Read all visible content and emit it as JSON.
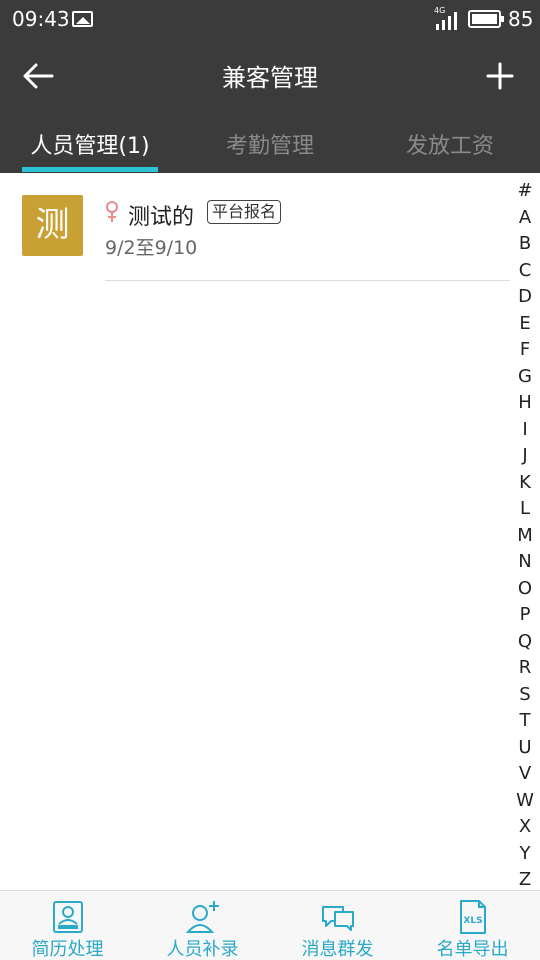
{
  "status_bar": {
    "time": "09:43",
    "network": "4G",
    "battery_level": "85"
  },
  "header": {
    "title": "兼客管理",
    "back_icon": "arrow-left-icon",
    "add_icon": "plus-icon"
  },
  "tabs": [
    {
      "label": "人员管理(1)",
      "active": true
    },
    {
      "label": "考勤管理",
      "active": false
    },
    {
      "label": "发放工资",
      "active": false
    }
  ],
  "people": [
    {
      "avatar_text": "测",
      "avatar_color": "#c9a033",
      "gender": "♀",
      "gender_color": "#e88b8b",
      "name": "测试的",
      "source": "平台报名",
      "dates": "9/2至9/10"
    }
  ],
  "index_letters": [
    "#",
    "A",
    "B",
    "C",
    "D",
    "E",
    "F",
    "G",
    "H",
    "I",
    "J",
    "K",
    "L",
    "M",
    "N",
    "O",
    "P",
    "Q",
    "R",
    "S",
    "T",
    "U",
    "V",
    "W",
    "X",
    "Y",
    "Z"
  ],
  "bottom_nav": [
    {
      "label": "简历处理",
      "icon": "resume-icon"
    },
    {
      "label": "人员补录",
      "icon": "add-person-icon"
    },
    {
      "label": "消息群发",
      "icon": "chat-bubbles-icon"
    },
    {
      "label": "名单导出",
      "icon": "xls-file-icon"
    }
  ],
  "colors": {
    "header_bg": "#3b3b3b",
    "accent": "#2cc5d6",
    "nav_text": "#2aa9c8"
  }
}
